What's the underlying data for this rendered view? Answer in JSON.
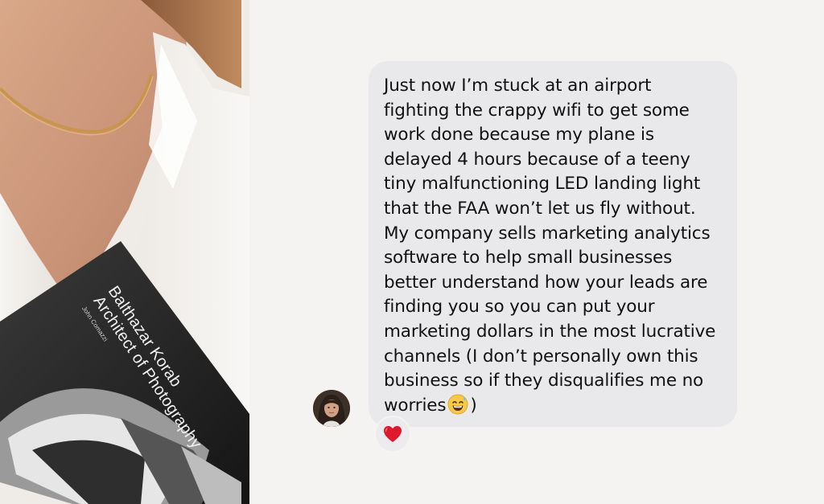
{
  "photo": {
    "book_title_line1": "Balthazar Korab",
    "book_title_line2": "Architect of Photography",
    "book_author": "John Comazzi"
  },
  "conversation": {
    "message_text": "Just now I’m stuck at an airport\nfighting the crappy wifi to get some\nwork done because my plane is\ndelayed 4 hours because of a teeny\ntiny malfunctioning LED landing light\nthat the FAA won’t let us fly without.\nMy company sells marketing analytics\nsoftware to help small businesses\nbetter understand how your leads are\nfinding you so you can put your\nmarketing dollars in the most lucrative\nchannels (I don’t personally own this\nbusiness so if they disqualifies me no\nworries",
    "message_closing": ")",
    "emoji": "grinning-sweat-emoji",
    "reaction": "red-heart-icon"
  },
  "colors": {
    "background": "#f4f3f1",
    "bubble": "#e9e9eb",
    "text": "#111111",
    "heart": "#e0182d"
  }
}
